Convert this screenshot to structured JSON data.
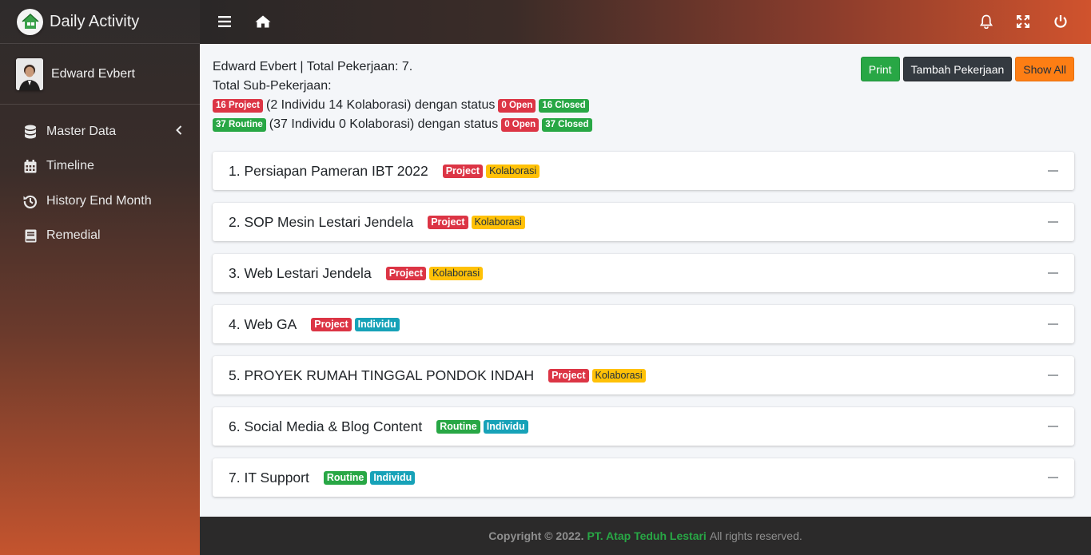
{
  "brand": {
    "name": "Daily Activity",
    "logo_icon": "house-icon"
  },
  "user": {
    "name": "Edward Evbert"
  },
  "nav": {
    "items": [
      {
        "label": "Master Data",
        "icon": "database-icon"
      },
      {
        "label": "Timeline",
        "icon": "calendar-icon"
      },
      {
        "label": "History End Month",
        "icon": "history-icon"
      },
      {
        "label": "Remedial",
        "icon": "book-icon"
      }
    ]
  },
  "header": {
    "menu_icon": "bars-icon",
    "home_icon": "home-icon",
    "bell_icon": "bell-icon",
    "expand_icon": "expand-icon",
    "power_icon": "power-icon"
  },
  "summary": {
    "line1": "Edward Evbert | Total Pekerjaan: 7.",
    "line2": "Total Sub-Pekerjaan:",
    "project": {
      "badge": "16 Project",
      "text": "(2 Individu 14 Kolaborasi) dengan status",
      "open": "0 Open",
      "closed": "16 Closed"
    },
    "routine": {
      "badge": "37 Routine",
      "text": "(37 Individu 0 Kolaborasi) dengan status",
      "open": "0 Open",
      "closed": "37 Closed"
    }
  },
  "actions": {
    "print": "Print",
    "add": "Tambah Pekerjaan",
    "show_all": "Show All"
  },
  "jobs": [
    {
      "title": "1. Persiapan Pameran IBT 2022",
      "type": "Project",
      "mode": "Kolaborasi"
    },
    {
      "title": "2. SOP Mesin Lestari Jendela",
      "type": "Project",
      "mode": "Kolaborasi"
    },
    {
      "title": "3. Web Lestari Jendela",
      "type": "Project",
      "mode": "Kolaborasi"
    },
    {
      "title": "4. Web GA",
      "type": "Project",
      "mode": "Individu"
    },
    {
      "title": "5. PROYEK RUMAH TINGGAL PONDOK INDAH",
      "type": "Project",
      "mode": "Kolaborasi"
    },
    {
      "title": "6. Social Media & Blog Content",
      "type": "Routine",
      "mode": "Individu"
    },
    {
      "title": "7. IT Support",
      "type": "Routine",
      "mode": "Individu"
    }
  ],
  "footer": {
    "copyright": "Copyright © 2022.",
    "company": "PT. Atap Teduh Lestari",
    "rest": "All rights reserved."
  },
  "colors": {
    "red": "#dc3545",
    "green": "#28a745",
    "yellow": "#ffc107",
    "cyan": "#17a2b8",
    "orange": "#fd7e14"
  }
}
